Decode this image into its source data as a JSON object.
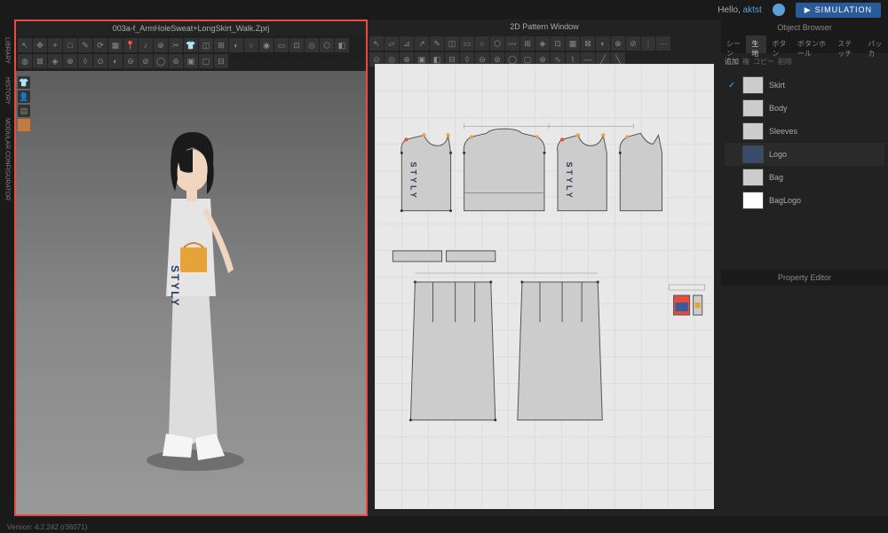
{
  "topbar": {
    "hello": "Hello,",
    "username": "aktst",
    "simulation_label": "SIMULATION"
  },
  "left_rail": {
    "tabs": [
      "LIBRARY",
      "HISTORY",
      "MODULAR CONFIGURATOR"
    ]
  },
  "viewport_3d": {
    "title": "003a-f_ArmHoleSweat+LongSkirt_Walk.Zprj",
    "graphic_text": "STYLY"
  },
  "viewport_2d": {
    "title": "2D Pattern Window",
    "graphic_text_front": "STYLY",
    "graphic_text_back": "STYLY"
  },
  "right_panel": {
    "browser_title": "Object Browser",
    "tabs": [
      "シーン",
      "生地",
      "ボタン",
      "ボタンホール",
      "ステッチ",
      "パッカ"
    ],
    "active_tab": 1,
    "sub_actions": [
      "追加",
      "複",
      "コピー",
      "削除"
    ],
    "layers": [
      {
        "name": "Skirt",
        "swatch": "norm",
        "checked": true
      },
      {
        "name": "Body",
        "swatch": "norm",
        "checked": false
      },
      {
        "name": "Sleeves",
        "swatch": "norm",
        "checked": false
      },
      {
        "name": "Logo",
        "swatch": "dark",
        "checked": false
      },
      {
        "name": "Bag",
        "swatch": "norm",
        "checked": false
      },
      {
        "name": "BagLogo",
        "swatch": "white",
        "checked": false
      }
    ],
    "property_title": "Property Editor"
  },
  "status_bar": {
    "version": "Version: 4.2.242 (r36071)"
  }
}
